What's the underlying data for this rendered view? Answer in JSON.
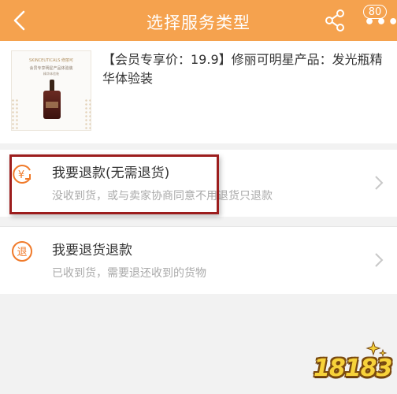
{
  "header": {
    "title": "选择服务类型",
    "badge_count": "80"
  },
  "product": {
    "name": "【会员专享价：19.9】修丽可明星产品：发光瓶精华体验装",
    "thumb_brand": "SKINCEUTICALS 修丽可",
    "thumb_line2": "会员专享明星产品体验装",
    "thumb_line3": "精华体验装"
  },
  "options": [
    {
      "title": "我要退款(无需退货)",
      "desc": "没收到货，或与卖家协商同意不用退货只退款",
      "icon": "refund-yen-icon"
    },
    {
      "title": "我要退货退款",
      "desc": "已收到货，需要退还收到的货物",
      "icon": "return-refund-icon",
      "icon_char": "退"
    }
  ],
  "watermark": {
    "text": "18183"
  },
  "colors": {
    "header": "#f5a24e",
    "accent": "#f07a2a",
    "highlight": "#9c1d1d"
  }
}
